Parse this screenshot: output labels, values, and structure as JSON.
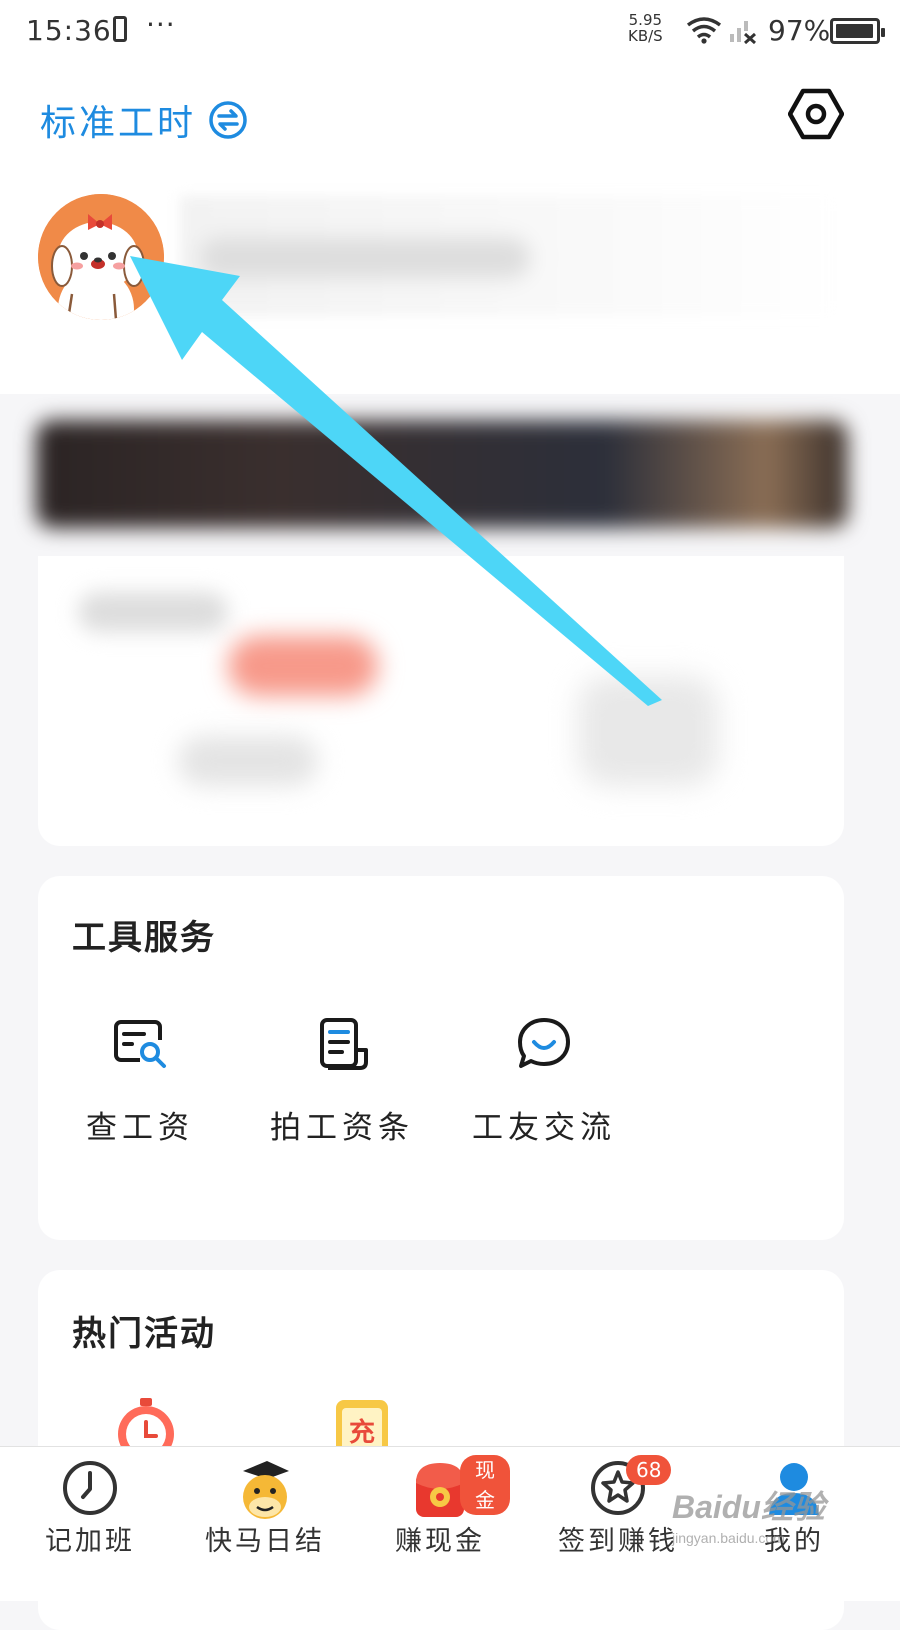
{
  "status_bar": {
    "time": "15:36",
    "more": "···",
    "speed_value": "5.95",
    "speed_unit": "KB/S",
    "battery": "97%"
  },
  "header": {
    "title": "标准工时",
    "accent_color": "#1e8be0"
  },
  "tools_section": {
    "title": "工具服务",
    "items": [
      {
        "label": "查工资",
        "icon": "salary-search-icon"
      },
      {
        "label": "拍工资条",
        "icon": "payslip-icon"
      },
      {
        "label": "工友交流",
        "icon": "chat-icon"
      }
    ]
  },
  "hot_section": {
    "title": "热门活动",
    "items": [
      {
        "icon": "alarm-clock-icon"
      },
      {
        "icon": "recharge-icon",
        "label": "充"
      }
    ]
  },
  "bottom_nav": {
    "items": [
      {
        "label": "记加班",
        "icon": "clock-icon"
      },
      {
        "label": "快马日结",
        "icon": "horse-mascot-icon"
      },
      {
        "label": "赚现金",
        "icon": "red-envelope-icon",
        "badge": "现金"
      },
      {
        "label": "签到赚钱",
        "icon": "star-checkin-icon",
        "badge": "68"
      },
      {
        "label": "我的",
        "icon": "user-icon",
        "active": true
      }
    ],
    "badge_color": "#f0533a",
    "active_color": "#1e8be0"
  },
  "watermark": {
    "text": "Baidu经验",
    "sub": "jingyan.baidu.com"
  },
  "annotation": {
    "arrow_color": "#4dd6f7"
  }
}
